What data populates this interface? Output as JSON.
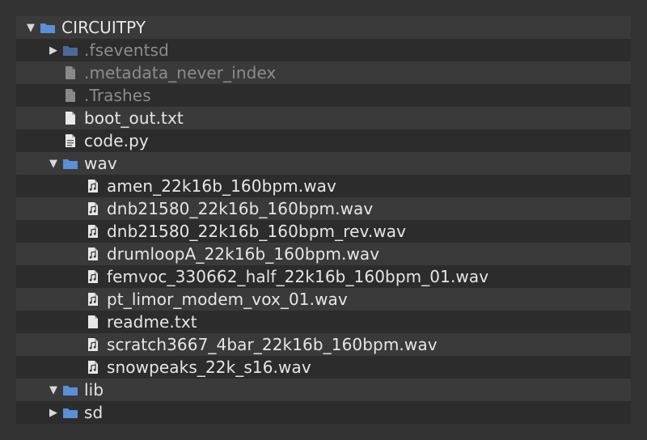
{
  "colors": {
    "folder": "#5b8fd6",
    "folder_dim": "#4a6a95",
    "file": "#e8e8e8",
    "file_dim": "#8a8a8a",
    "text": "#e6e6e6",
    "text_dim": "#8c8c8c"
  },
  "tree": {
    "root": {
      "label": "CIRCUITPY",
      "expanded": true,
      "icon": "folder-icon"
    },
    "items": [
      {
        "label": ".fseventsd",
        "type": "folder",
        "expanded": false,
        "hidden": true
      },
      {
        "label": ".metadata_never_index",
        "type": "file",
        "hidden": true
      },
      {
        "label": ".Trashes",
        "type": "file",
        "hidden": true
      },
      {
        "label": "boot_out.txt",
        "type": "file"
      },
      {
        "label": "code.py",
        "type": "python-file"
      },
      {
        "label": "wav",
        "type": "folder",
        "expanded": true
      },
      {
        "label": "amen_22k16b_160bpm.wav",
        "type": "audio-file"
      },
      {
        "label": "dnb21580_22k16b_160bpm.wav",
        "type": "audio-file"
      },
      {
        "label": "dnb21580_22k16b_160bpm_rev.wav",
        "type": "audio-file"
      },
      {
        "label": "drumloopA_22k16b_160bpm.wav",
        "type": "audio-file"
      },
      {
        "label": "femvoc_330662_half_22k16b_160bpm_01.wav",
        "type": "audio-file"
      },
      {
        "label": "pt_limor_modem_vox_01.wav",
        "type": "audio-file"
      },
      {
        "label": "readme.txt",
        "type": "file"
      },
      {
        "label": "scratch3667_4bar_22k16b_160bpm.wav",
        "type": "audio-file"
      },
      {
        "label": "snowpeaks_22k_s16.wav",
        "type": "audio-file"
      },
      {
        "label": "lib",
        "type": "folder",
        "expanded": true
      },
      {
        "label": "sd",
        "type": "folder",
        "expanded": false
      }
    ]
  },
  "toggles": {
    "expanded": "▼",
    "collapsed": "▶"
  }
}
